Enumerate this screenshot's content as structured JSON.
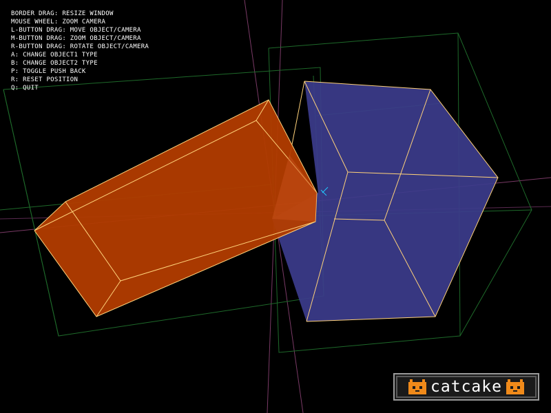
{
  "help": {
    "lines": [
      "BORDER DRAG: RESIZE WINDOW",
      "MOUSE WHEEL: ZOOM CAMERA",
      "L-BUTTON DRAG: MOVE OBJECT/CAMERA",
      "M-BUTTON DRAG: ZOOM OBJECT/CAMERA",
      "R-BUTTON DRAG: ROTATE OBJECT/CAMERA",
      "A: CHANGE OBJECT1 TYPE",
      "B: CHANGE OBJECT2 TYPE",
      "P: TOGGLE PUSH BACK",
      "R: RESET POSITION",
      "Q: QUIT"
    ]
  },
  "logo": {
    "text": "catcake"
  },
  "scene": {
    "object1": {
      "type": "box",
      "color": "#b23c00",
      "edge_color": "#ffd27a"
    },
    "object2": {
      "type": "box",
      "color": "#3c3c8c",
      "edge_color": "#ffd27a"
    },
    "bounds_color": "#1f6e2a",
    "axis_color": "#8a3a6a"
  }
}
